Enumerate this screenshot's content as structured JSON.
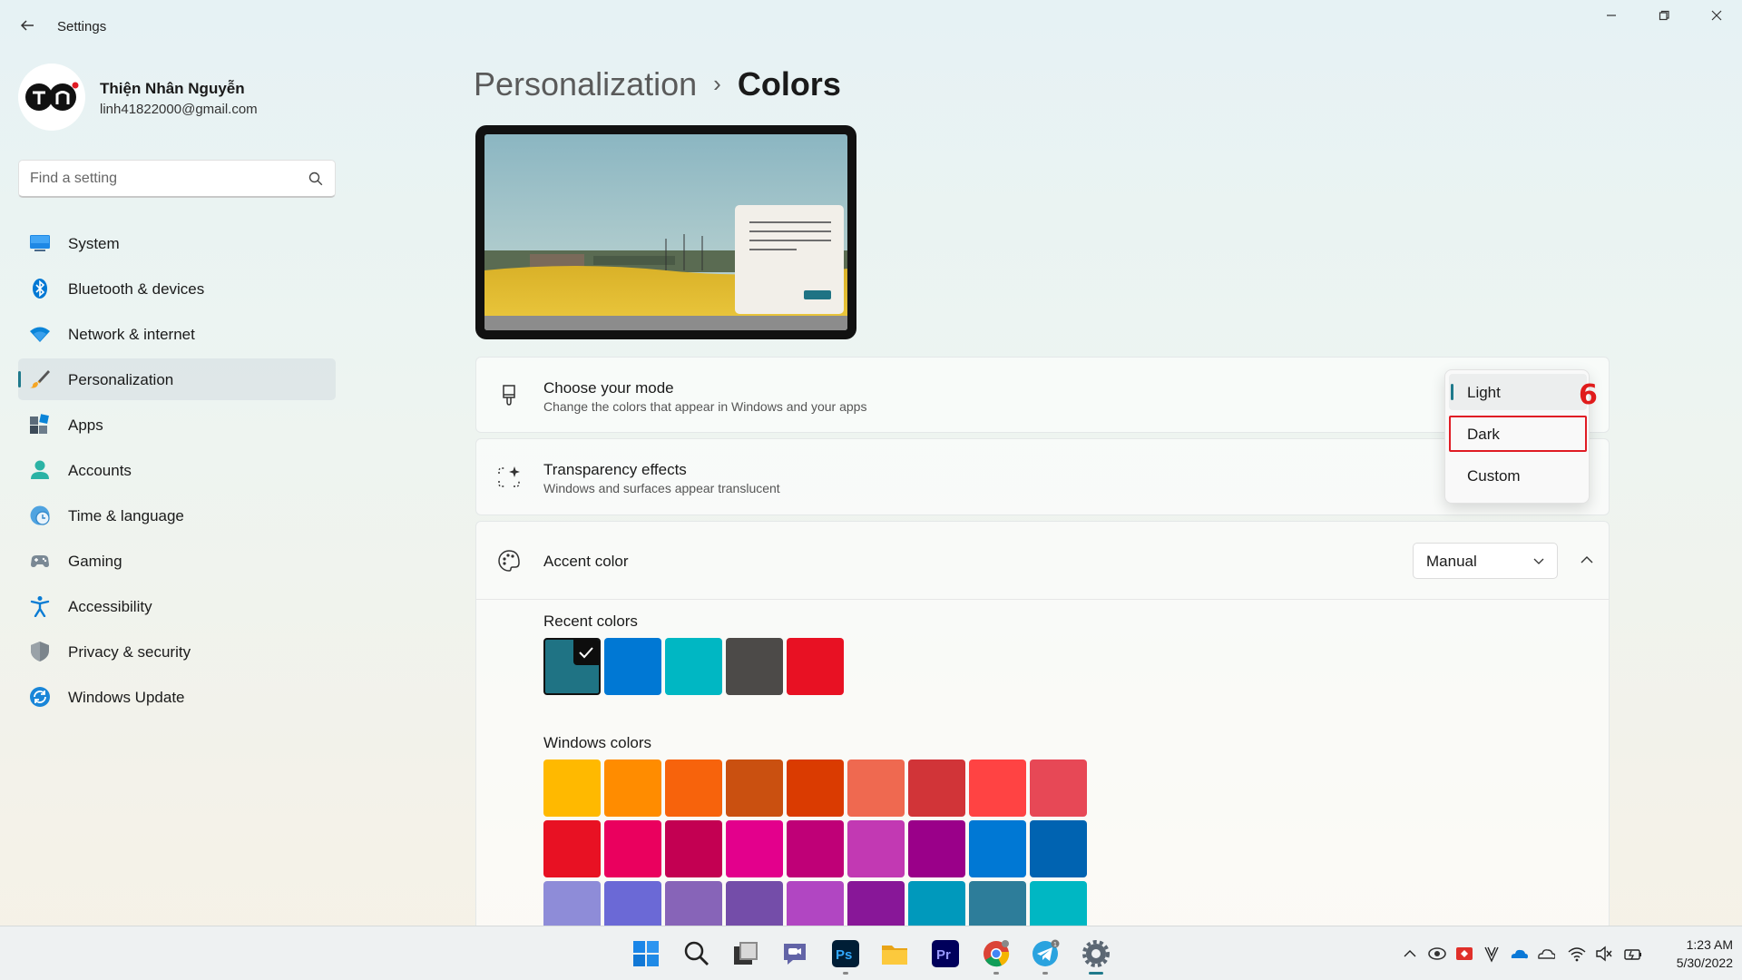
{
  "window": {
    "title": "Settings",
    "back_icon": "back-arrow-icon",
    "controls": [
      "minimize-icon",
      "maximize-icon",
      "close-icon"
    ]
  },
  "profile": {
    "name": "Thiện Nhân Nguyễn",
    "email": "linh41822000@gmail.com",
    "avatar_text": "TN"
  },
  "search": {
    "placeholder": "Find a setting",
    "icon": "search-icon"
  },
  "sidebar": {
    "items": [
      {
        "label": "System",
        "icon": "system-icon",
        "active": false
      },
      {
        "label": "Bluetooth & devices",
        "icon": "bluetooth-icon",
        "active": false
      },
      {
        "label": "Network & internet",
        "icon": "wifi-icon",
        "active": false
      },
      {
        "label": "Personalization",
        "icon": "brush-icon",
        "active": true
      },
      {
        "label": "Apps",
        "icon": "apps-icon",
        "active": false
      },
      {
        "label": "Accounts",
        "icon": "person-icon",
        "active": false
      },
      {
        "label": "Time & language",
        "icon": "clock-globe-icon",
        "active": false
      },
      {
        "label": "Gaming",
        "icon": "gamepad-icon",
        "active": false
      },
      {
        "label": "Accessibility",
        "icon": "accessibility-icon",
        "active": false
      },
      {
        "label": "Privacy & security",
        "icon": "shield-icon",
        "active": false
      },
      {
        "label": "Windows Update",
        "icon": "update-icon",
        "active": false
      }
    ]
  },
  "breadcrumb": {
    "parent": "Personalization",
    "separator": "›",
    "current": "Colors"
  },
  "mode_card": {
    "title": "Choose your mode",
    "subtitle": "Change the colors that appear in Windows and your apps",
    "icon": "paint-brush-icon"
  },
  "transparency_card": {
    "title": "Transparency effects",
    "subtitle": "Windows and surfaces appear translucent",
    "icon": "transparency-sparkle-icon"
  },
  "mode_menu": {
    "options": [
      "Light",
      "Dark",
      "Custom"
    ],
    "selected": "Light",
    "highlighted": "Dark",
    "step_label": "6"
  },
  "accent_card": {
    "title": "Accent color",
    "icon": "palette-icon",
    "dropdown_value": "Manual",
    "recent_label": "Recent colors",
    "recent_colors": [
      "#1f7384",
      "#0078d4",
      "#00b7c3",
      "#4c4a48",
      "#e81123"
    ],
    "windows_label": "Windows colors",
    "windows_colors": [
      [
        "#ffb900",
        "#ff8c00",
        "#f7630c",
        "#ca5010",
        "#da3b01",
        "#ef6950",
        "#d13438",
        "#ff4343",
        "#e74856"
      ],
      [
        "#e81123",
        "#ea005e",
        "#c30052",
        "#e3008c",
        "#bf0077",
        "#c239b3",
        "#9a0089",
        "#0078d4",
        "#0063b1"
      ],
      [
        "#8e8cd8",
        "#6b69d6",
        "#8764b8",
        "#744da9",
        "#b146c2",
        "#881798",
        "#0099bc",
        "#2d7d9a",
        "#00b7c3"
      ]
    ]
  },
  "taskbar": {
    "apps": [
      "windows-start-icon",
      "search-icon",
      "task-view-icon",
      "chat-icon",
      "photoshop-icon",
      "file-explorer-icon",
      "premiere-icon",
      "chrome-icon",
      "telegram-icon",
      "settings-gear-icon"
    ],
    "tray": [
      "chevron-up-icon",
      "tray-app-icon",
      "anydesk-icon",
      "v-app-icon",
      "onedrive-icon",
      "cloud-icon",
      "wifi-icon",
      "volume-muted-icon",
      "battery-icon"
    ],
    "time": "1:23 AM",
    "date": "5/30/2022"
  }
}
